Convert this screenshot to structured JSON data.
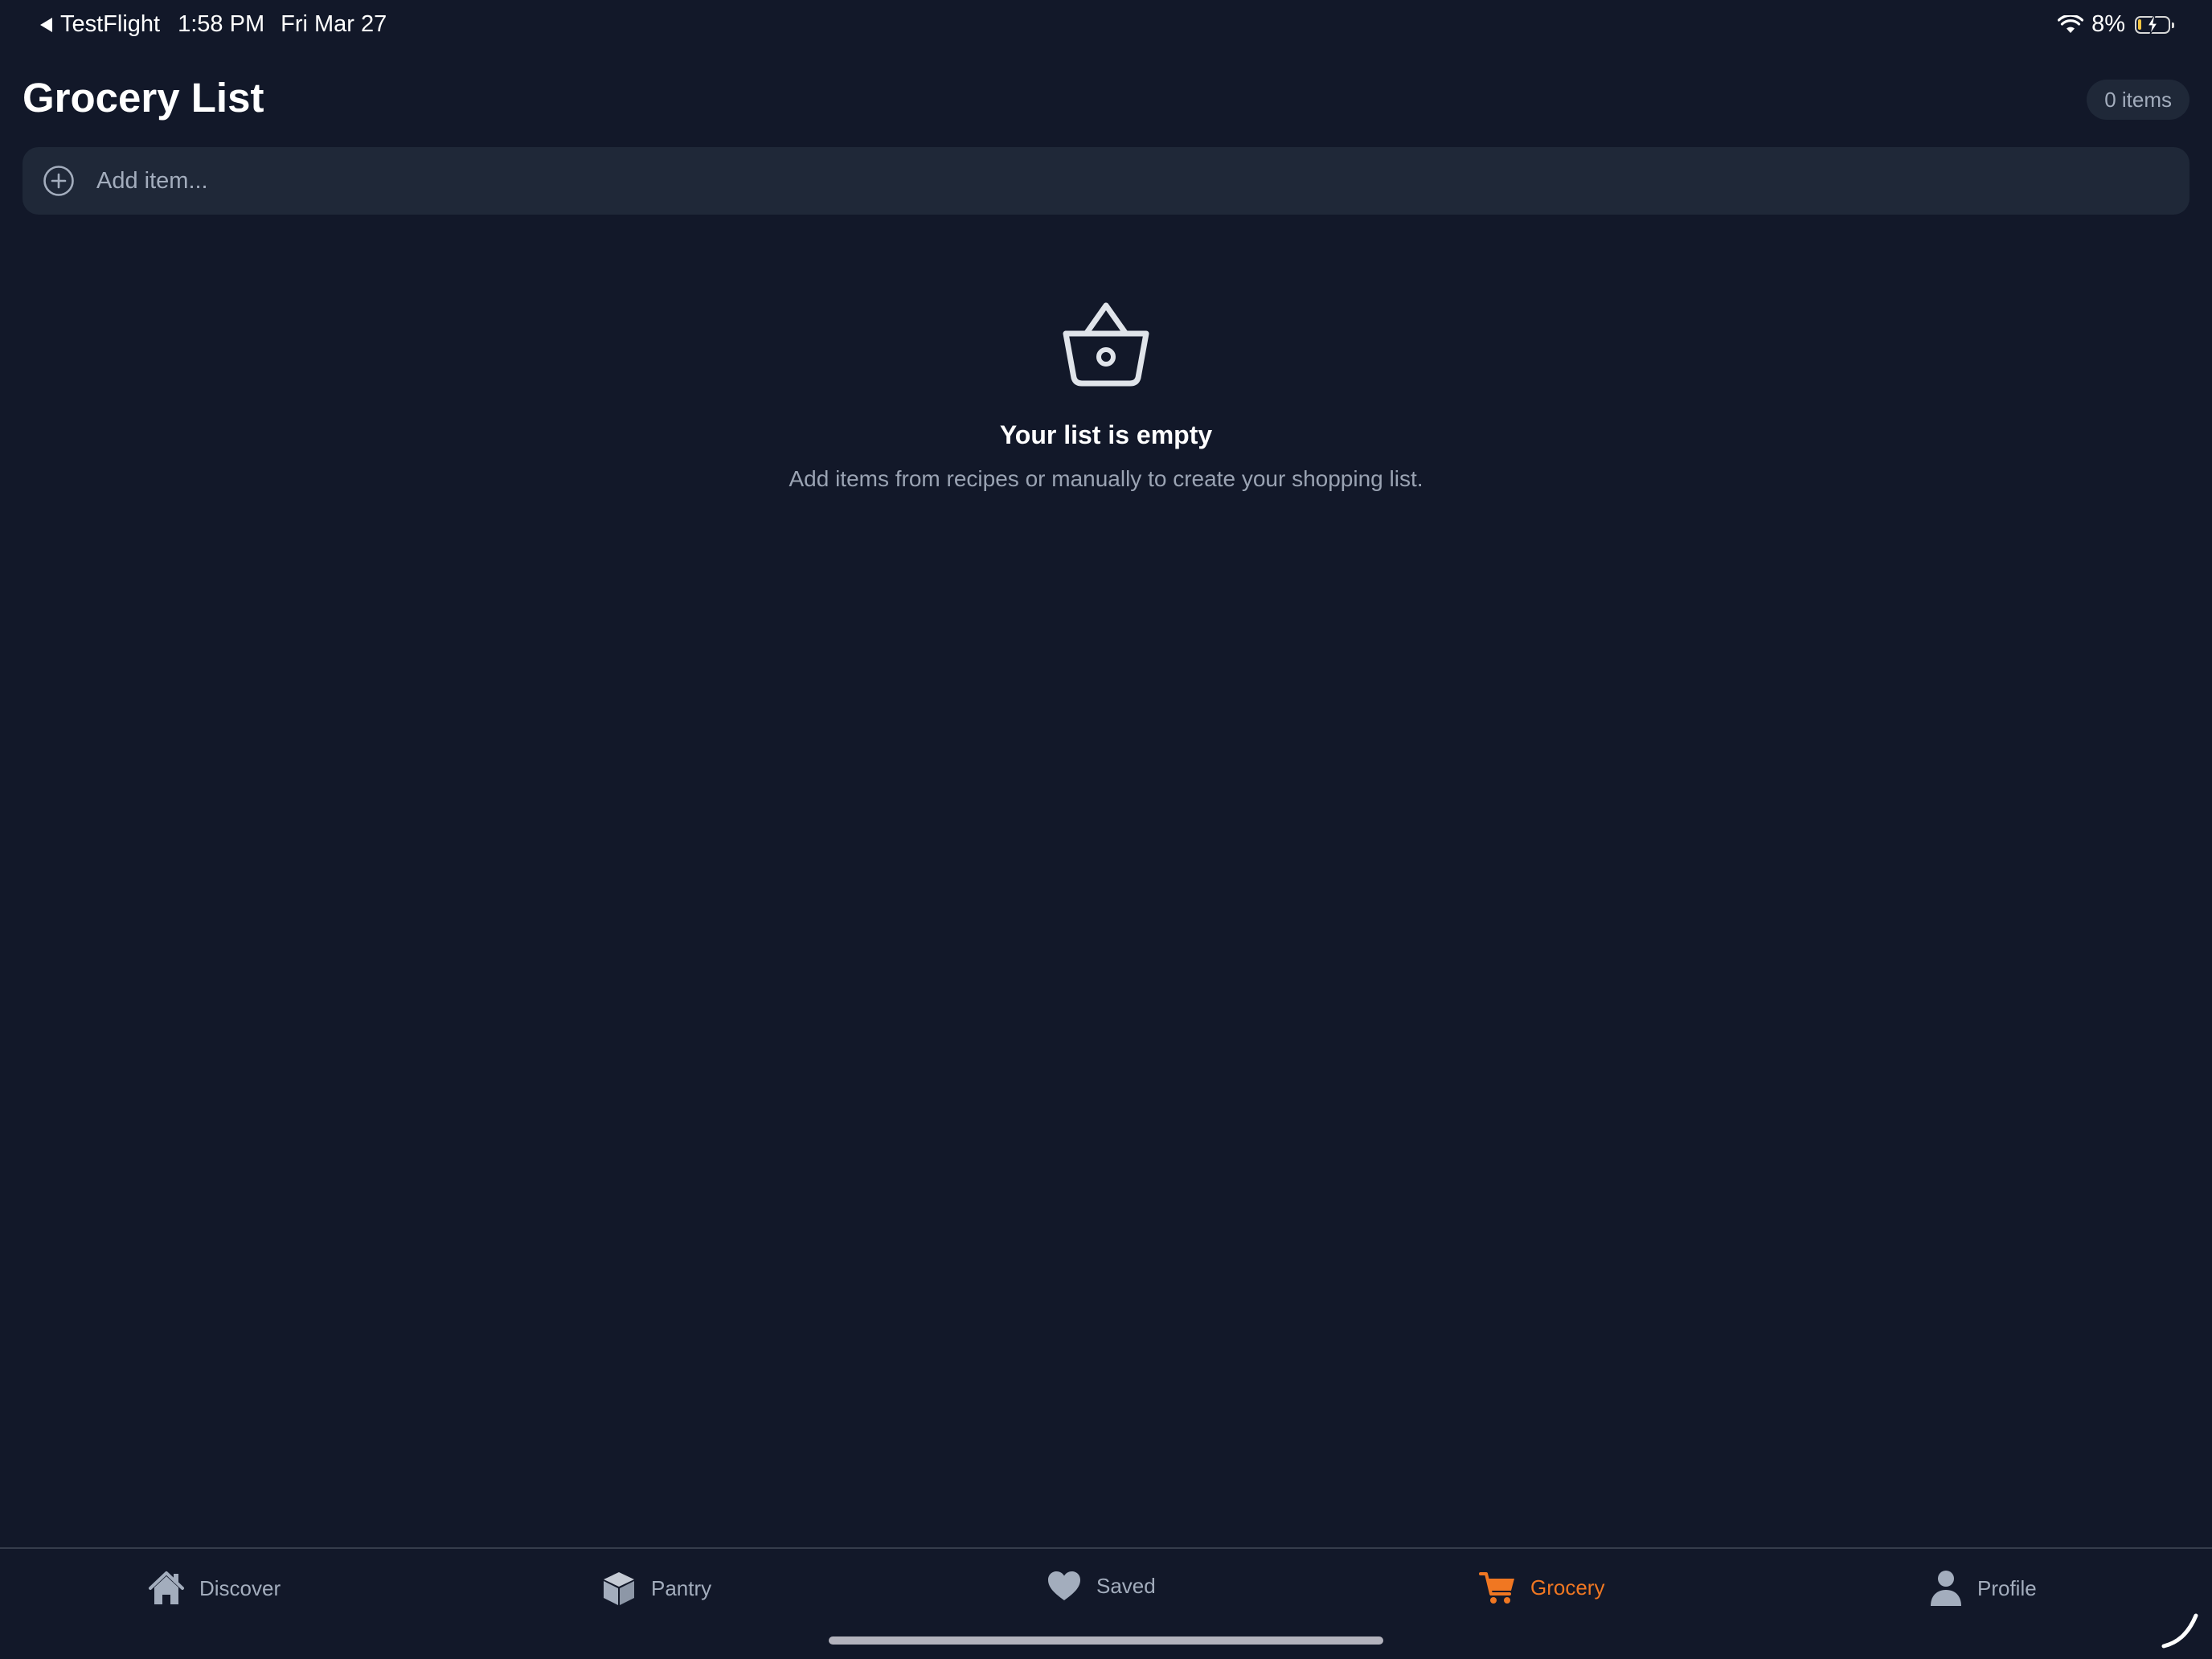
{
  "status_bar": {
    "back_app": "TestFlight",
    "time": "1:58 PM",
    "date": "Fri Mar 27",
    "battery": "8%"
  },
  "header": {
    "title": "Grocery List",
    "count": "0 items"
  },
  "add_bar": {
    "placeholder": "Add item..."
  },
  "empty_state": {
    "title": "Your list is empty",
    "subtitle": "Add items from recipes or manually to create your shopping list."
  },
  "tabs": [
    {
      "label": "Discover",
      "icon": "home-icon"
    },
    {
      "label": "Pantry",
      "icon": "box-icon"
    },
    {
      "label": "Saved",
      "icon": "heart-icon"
    },
    {
      "label": "Grocery",
      "icon": "cart-icon",
      "active": true
    },
    {
      "label": "Profile",
      "icon": "person-icon"
    }
  ],
  "colors": {
    "background": "#121829",
    "surface": "#1f2838",
    "accent": "#f07722",
    "muted": "#a3adbd"
  }
}
